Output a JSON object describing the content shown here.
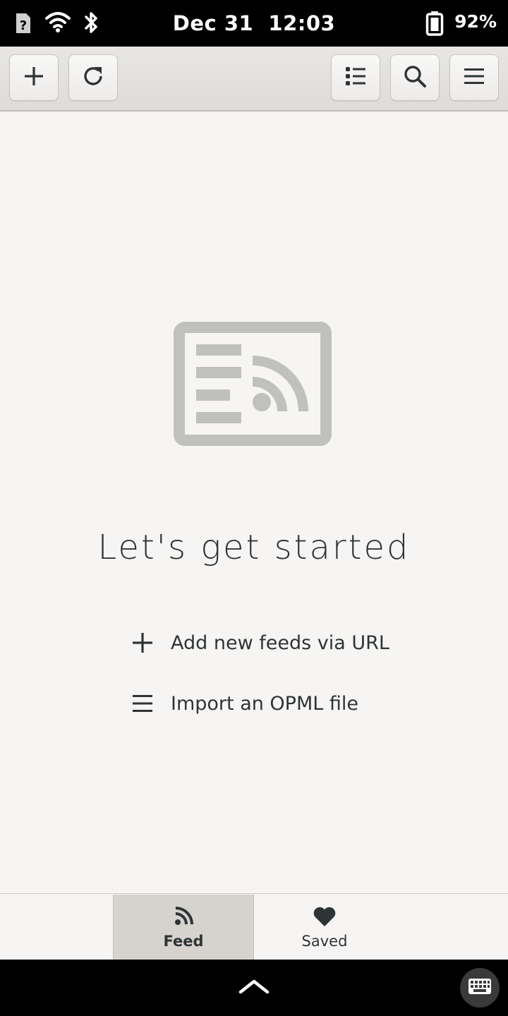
{
  "status_bar": {
    "date": "Dec 31",
    "time": "12:03",
    "battery": "92%",
    "icons": [
      "sim-unknown-icon",
      "wifi-icon",
      "bluetooth-icon",
      "battery-icon"
    ]
  },
  "header": {
    "buttons": [
      "add-icon",
      "refresh-icon",
      "list-view-icon",
      "search-icon",
      "menu-icon"
    ]
  },
  "empty_state": {
    "icon": "feed-reader-icon",
    "title": "Let's get started",
    "actions": [
      {
        "icon": "plus-icon",
        "label": "Add new feeds via URL"
      },
      {
        "icon": "list-icon",
        "label": "Import an OPML file"
      }
    ]
  },
  "view_switcher": {
    "items": [
      {
        "label": "Feed",
        "icon": "rss-icon",
        "active": true
      },
      {
        "label": "Saved",
        "icon": "heart-icon",
        "active": false
      }
    ]
  },
  "bottom_bar": {
    "icons": [
      "chevron-up-icon",
      "keyboard-icon"
    ]
  },
  "colors": {
    "icon_gray": "#c0c1be",
    "text": "#2e3436",
    "background": "#f6f5f4"
  }
}
